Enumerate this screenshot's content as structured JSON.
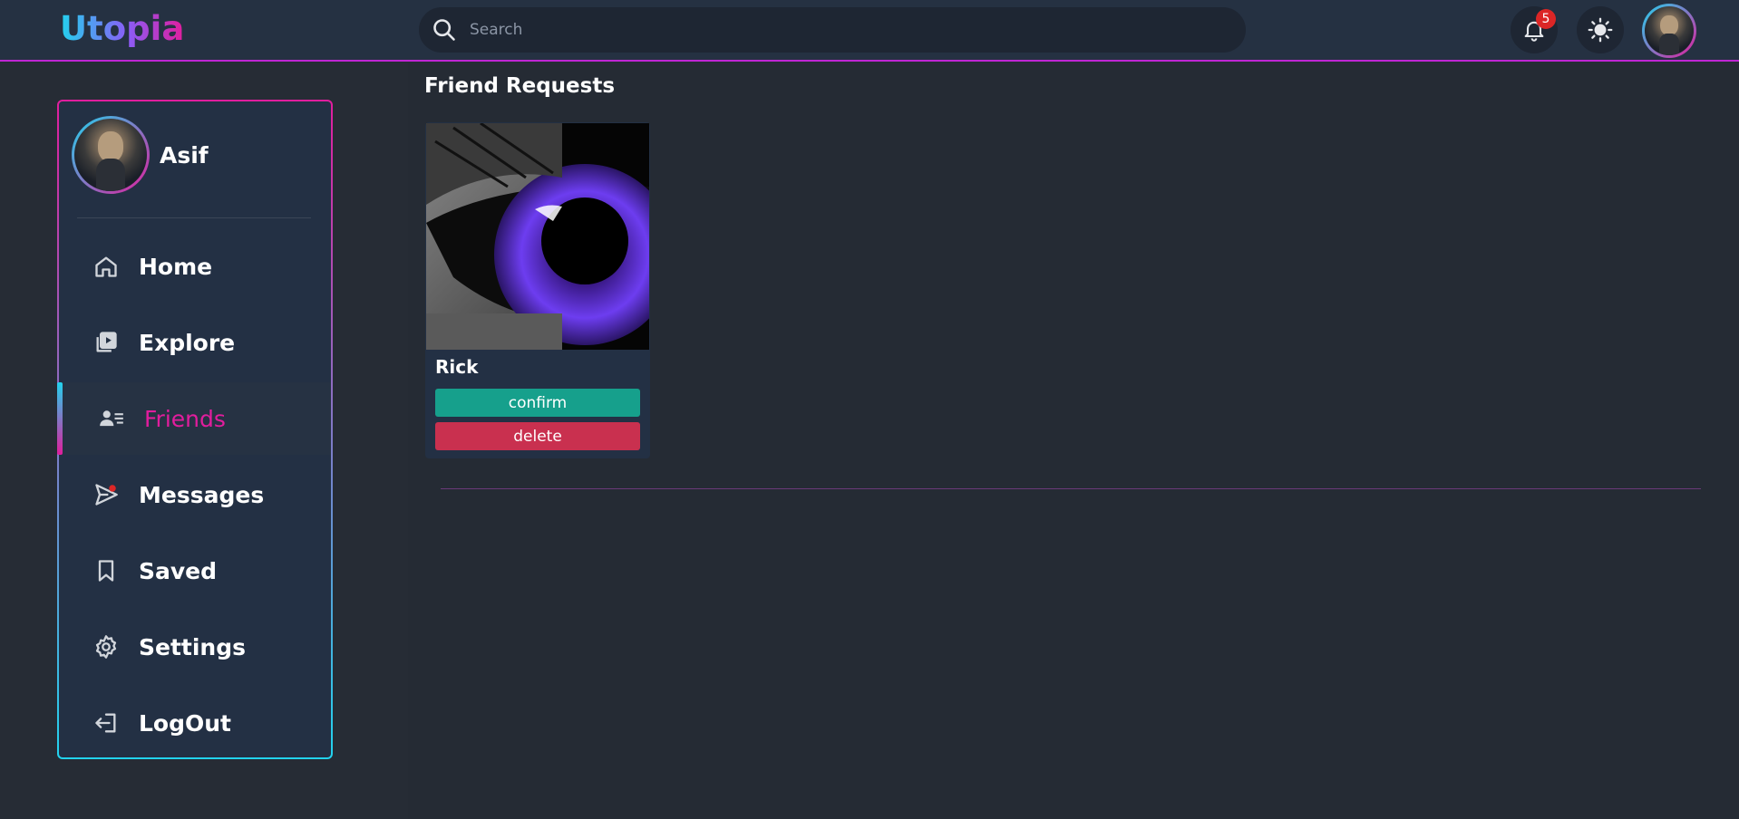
{
  "header": {
    "logo": "Utopia",
    "search_placeholder": "Search",
    "notification_count": "5"
  },
  "sidebar": {
    "profile_name": "Asif",
    "items": [
      {
        "label": "Home",
        "icon": "home-icon"
      },
      {
        "label": "Explore",
        "icon": "explore-icon"
      },
      {
        "label": "Friends",
        "icon": "friends-icon",
        "active": true
      },
      {
        "label": "Messages",
        "icon": "messages-icon"
      },
      {
        "label": "Saved",
        "icon": "bookmark-icon"
      },
      {
        "label": "Settings",
        "icon": "gear-icon"
      },
      {
        "label": "LogOut",
        "icon": "logout-icon"
      }
    ]
  },
  "main": {
    "title": "Friend Requests",
    "requests": [
      {
        "name": "Rick",
        "confirm_label": "confirm",
        "delete_label": "delete"
      }
    ]
  },
  "colors": {
    "accent_cyan": "#22d3ee",
    "accent_magenta": "#e11d9d",
    "confirm": "#16a08c",
    "delete": "#c9304f"
  }
}
